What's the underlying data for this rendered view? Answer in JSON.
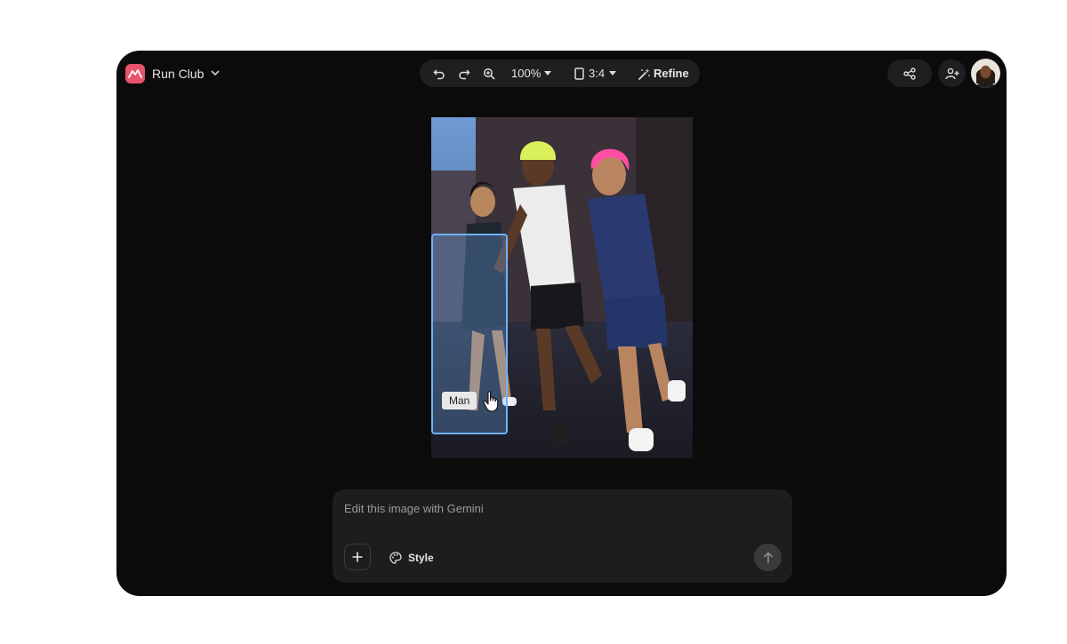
{
  "header": {
    "project_name": "Run Club",
    "zoom_label": "100%",
    "aspect_label": "3:4",
    "refine_label": "Refine"
  },
  "canvas": {
    "selection_tag": "Man"
  },
  "prompt": {
    "placeholder": "Edit this image with Gemini",
    "style_label": "Style"
  },
  "colors": {
    "app_bg": "#0b0b0c",
    "toolbar_pill": "#1f1f21",
    "brand_logo": "#e8556b",
    "selection": "#6fb2ff"
  },
  "icons": {
    "logo": "app-logo-icon",
    "undo": "undo-icon",
    "redo": "redo-icon",
    "zoom": "zoom-in-icon",
    "aspect": "aspect-ratio-icon",
    "refine": "magic-wand-icon",
    "share": "share-icon",
    "add_person": "add-person-icon",
    "add": "plus-icon",
    "palette": "palette-icon",
    "send": "send-arrow-icon",
    "cursor": "hand-pointer-icon"
  }
}
